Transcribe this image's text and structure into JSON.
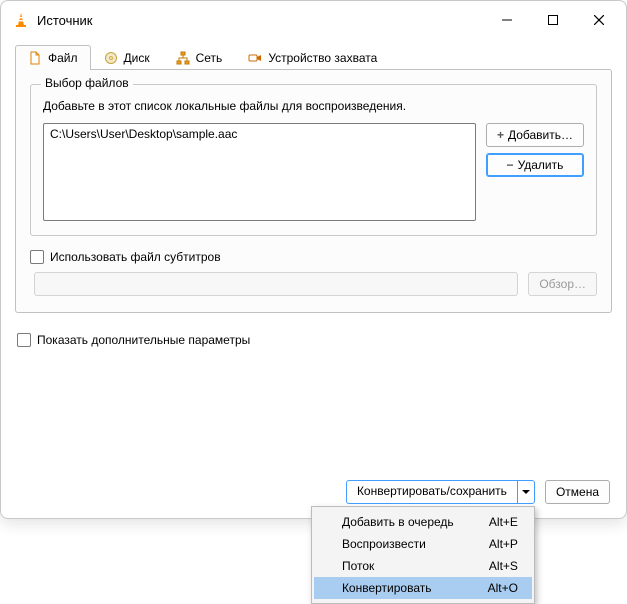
{
  "window": {
    "title": "Источник"
  },
  "tabs": {
    "file": "Файл",
    "disc": "Диск",
    "network": "Сеть",
    "capture": "Устройство захвата"
  },
  "fileGroup": {
    "title": "Выбор файлов",
    "hint": "Добавьте в этот список локальные файлы для воспроизведения.",
    "items": [
      "C:\\Users\\User\\Desktop\\sample.aac"
    ],
    "addLabel": "Добавить…",
    "removeLabel": "Удалить"
  },
  "subtitles": {
    "checkboxLabel": "Использовать файл субтитров",
    "browseLabel": "Обзор…"
  },
  "options": {
    "showMore": "Показать дополнительные параметры"
  },
  "footer": {
    "convertSave": "Конвертировать/сохранить",
    "cancel": "Отмена"
  },
  "menu": {
    "items": [
      {
        "label": "Добавить в очередь",
        "shortcut": "Alt+E"
      },
      {
        "label": "Воспроизвести",
        "shortcut": "Alt+P"
      },
      {
        "label": "Поток",
        "shortcut": "Alt+S"
      },
      {
        "label": "Конвертировать",
        "shortcut": "Alt+O",
        "highlight": true
      }
    ]
  }
}
